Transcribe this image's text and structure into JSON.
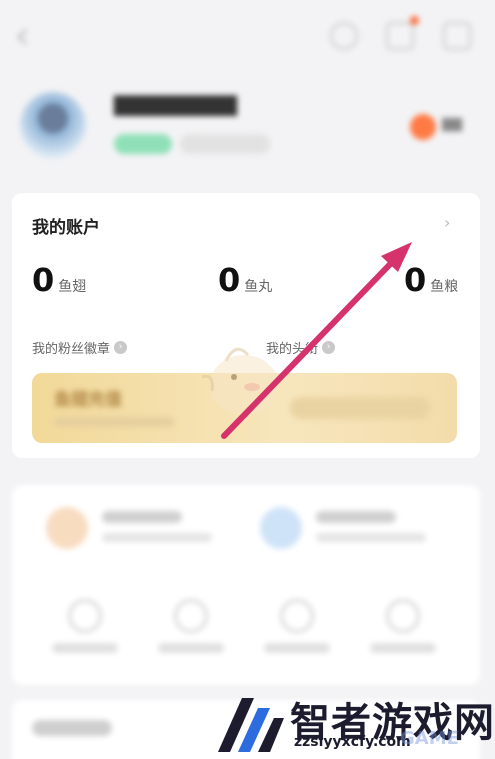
{
  "account": {
    "title": "我的账户",
    "stats": [
      {
        "value": "0",
        "unit": "鱼翅"
      },
      {
        "value": "0",
        "unit": "鱼丸"
      },
      {
        "value": "0",
        "unit": "鱼粮"
      }
    ],
    "links": [
      {
        "label": "我的粉丝徽章"
      },
      {
        "label": "我的头衔"
      }
    ],
    "recharge": {
      "label": "鱼翅充值"
    }
  },
  "watermark": {
    "brand": "智者游戏网",
    "url": "zzslyyxcfy.com",
    "faint": "GAME"
  },
  "colors": {
    "arrow": "#d6336c",
    "recharge_bg": "#f2d999",
    "page_bg": "#f3f3f5"
  },
  "icons": [
    "back-icon",
    "message-icon",
    "notification-icon",
    "settings-icon",
    "chevron-right-icon",
    "circle-arrow-icon"
  ]
}
